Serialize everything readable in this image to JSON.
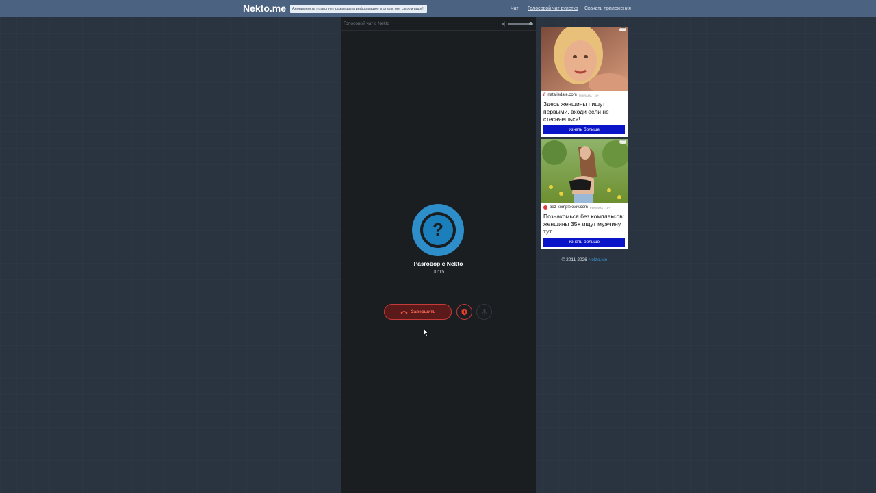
{
  "header": {
    "logo": "Nekto.me",
    "notice": "Анонимность позволяет размещать информацию в открытом, сыром виде!",
    "nav": [
      "Чат",
      "Голосовой чат рулетка",
      "Скачать приложения"
    ]
  },
  "chat": {
    "panel_title": "Голосовой чат с Nekto",
    "volume_level": 0.9,
    "call_title": "Разговор с Nekto",
    "timer": "00:15",
    "end_button_label": "Завершить",
    "avatar_symbol": "?"
  },
  "ads": [
    {
      "source": "nataliedate.com",
      "tag": "РЕКЛАМА • 18+",
      "headline": "Здесь женщины пишут первыми, входи если не стесняешься!",
      "cta": "Узнать больше"
    },
    {
      "source": "bez-kompleksov.com",
      "tag": "РЕКЛАМА • 18+",
      "headline": "Познакомься без комплексов: женщины 35+ ищут мужчину тут",
      "cta": "Узнать больше"
    }
  ],
  "footer": {
    "copyright": "© 2011-2026",
    "link": "Nekto.Me"
  },
  "colors": {
    "header_bg": "#4b6280",
    "page_bg": "#2a3440",
    "panel_bg": "#1b1e21",
    "accent_blue": "#2d8ec9",
    "danger_red": "#c73a3a",
    "ad_cta_blue": "#0a14c8"
  }
}
